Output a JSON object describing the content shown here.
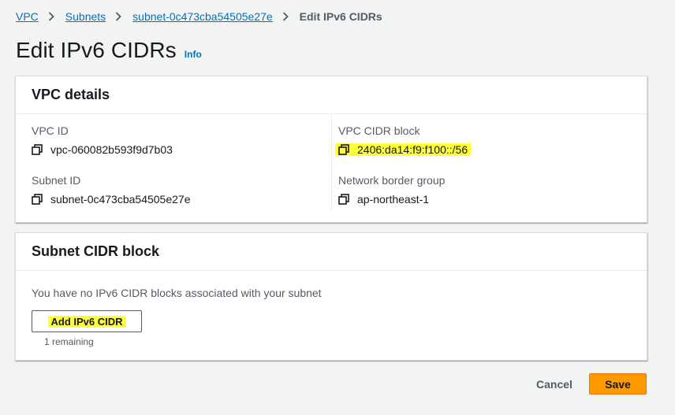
{
  "breadcrumb": {
    "items": [
      {
        "label": "VPC"
      },
      {
        "label": "Subnets"
      },
      {
        "label": "subnet-0c473cba54505e27e"
      }
    ],
    "current": "Edit IPv6 CIDRs"
  },
  "page": {
    "title": "Edit IPv6 CIDRs",
    "info_label": "Info"
  },
  "vpc_details": {
    "heading": "VPC details",
    "vpc_id_label": "VPC ID",
    "vpc_id": "vpc-060082b593f9d7b03",
    "subnet_id_label": "Subnet ID",
    "subnet_id": "subnet-0c473cba54505e27e",
    "vpc_cidr_label": "VPC CIDR block",
    "vpc_cidr": "2406:da14:f9:f100::/56",
    "border_group_label": "Network border group",
    "border_group": "ap-northeast-1"
  },
  "subnet_cidr": {
    "heading": "Subnet CIDR block",
    "empty_message": "You have no IPv6 CIDR blocks associated with your subnet",
    "add_button": "Add IPv6 CIDR",
    "remaining": "1 remaining"
  },
  "actions": {
    "cancel": "Cancel",
    "save": "Save"
  },
  "colors": {
    "link": "#0073bb",
    "primary": "#ff9900",
    "highlight": "#ffff3a"
  },
  "icons": {
    "breadcrumb_separator": "chevron-right-icon",
    "copy": "copy-icon"
  }
}
